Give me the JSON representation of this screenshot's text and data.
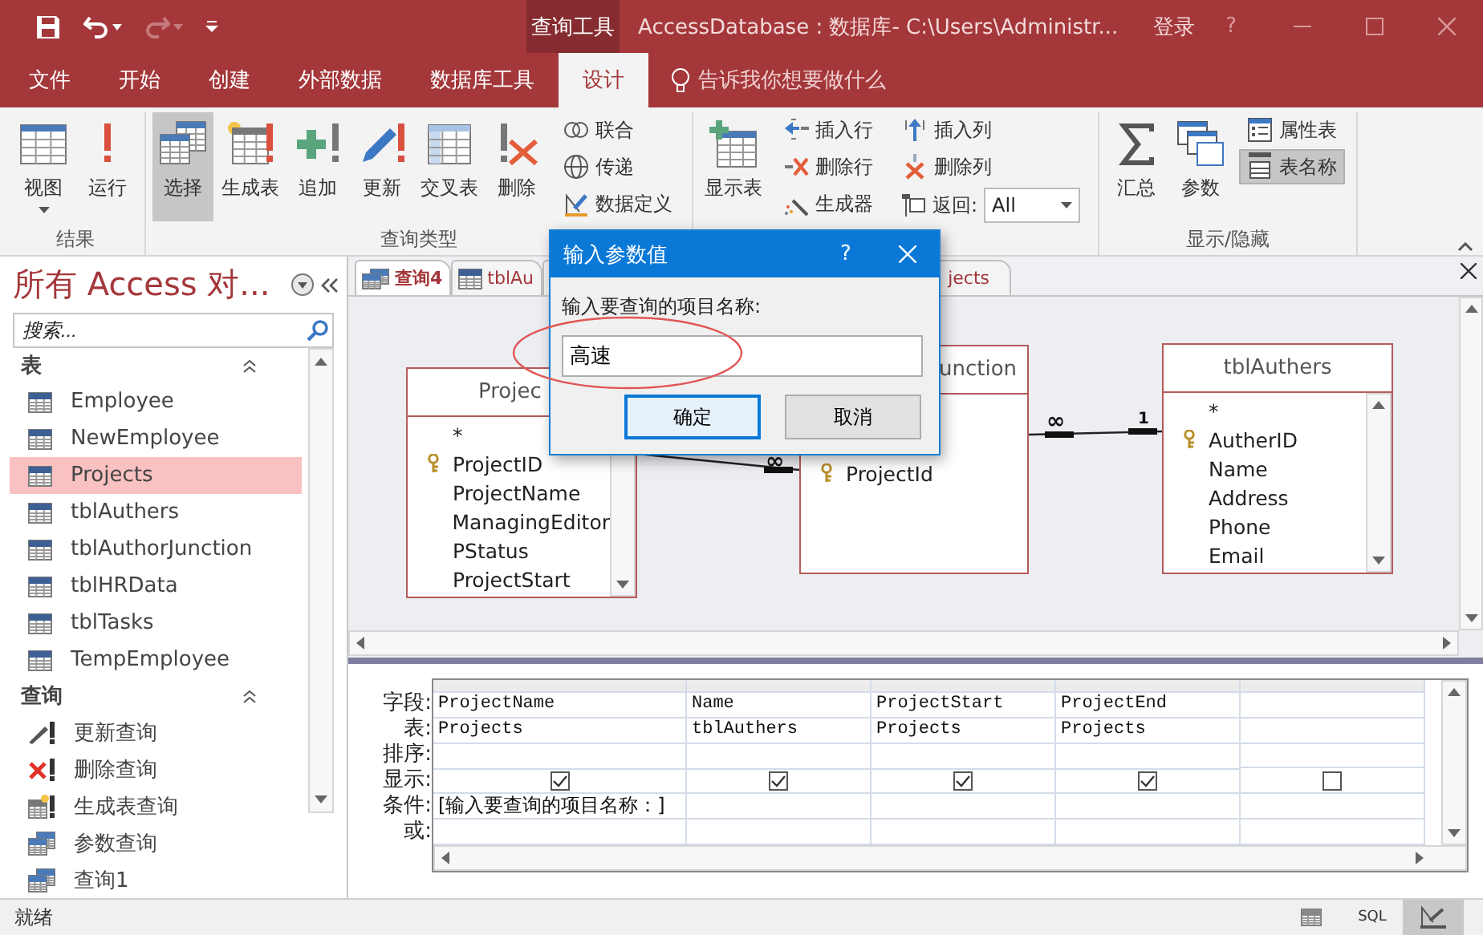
{
  "title_bar": {
    "context_tab": "查询工具",
    "title": "AccessDatabase : 数据库- C:\\Users\\Administr...",
    "sign_in": "登录",
    "help": "?",
    "redo_disabled": true
  },
  "ribbon_tabs": [
    {
      "label": "文件",
      "selected": false
    },
    {
      "label": "开始",
      "selected": false
    },
    {
      "label": "创建",
      "selected": false
    },
    {
      "label": "外部数据",
      "selected": false
    },
    {
      "label": "数据库工具",
      "selected": false
    },
    {
      "label": "设计",
      "selected": true
    }
  ],
  "tell_me": "告诉我你想要做什么",
  "ribbon_groups": [
    {
      "label": "结果",
      "items": [
        {
          "kind": "large",
          "label": "视图",
          "dropdown": true,
          "selected": false
        },
        {
          "kind": "large",
          "label": "运行",
          "dropdown": false,
          "selected": false
        }
      ]
    },
    {
      "label": "查询类型",
      "items": [
        {
          "kind": "large",
          "label": "选择",
          "dropdown": false,
          "selected": true
        },
        {
          "kind": "large",
          "label": "生成表",
          "dropdown": false,
          "selected": false
        },
        {
          "kind": "large",
          "label": "追加",
          "dropdown": false,
          "selected": false
        },
        {
          "kind": "large",
          "label": "更新",
          "dropdown": false,
          "selected": false
        },
        {
          "kind": "large",
          "label": "交叉表",
          "dropdown": false,
          "selected": false
        },
        {
          "kind": "large",
          "label": "删除",
          "dropdown": false,
          "selected": false
        },
        {
          "kind": "stack",
          "buttons": [
            {
              "kind": "button",
              "label": "联合",
              "selected": false
            },
            {
              "kind": "button",
              "label": "传递",
              "selected": false
            },
            {
              "kind": "button",
              "label": "数据定义",
              "selected": false
            }
          ]
        }
      ]
    },
    {
      "items": [
        {
          "kind": "large",
          "label": "显示表",
          "dropdown": false,
          "selected": false
        },
        {
          "kind": "stack",
          "buttons": [
            {
              "kind": "button",
              "label": "插入行",
              "selected": false
            },
            {
              "kind": "button",
              "label": "删除行",
              "selected": false
            },
            {
              "kind": "button",
              "label": "生成器",
              "selected": false
            }
          ]
        },
        {
          "kind": "stack",
          "buttons": [
            {
              "kind": "button",
              "label": "插入列",
              "selected": false
            },
            {
              "kind": "button",
              "label": "删除列",
              "selected": false
            },
            {
              "kind": "combo",
              "label": "返回:",
              "value": "All"
            }
          ]
        }
      ]
    },
    {
      "label": "显示/隐藏",
      "items": [
        {
          "kind": "large",
          "label": "汇总",
          "dropdown": false,
          "selected": false
        },
        {
          "kind": "large",
          "label": "参数",
          "dropdown": false,
          "selected": false
        },
        {
          "kind": "stack",
          "buttons": [
            {
              "kind": "button",
              "label": "属性表",
              "selected": false
            },
            {
              "kind": "button",
              "label": "表名称",
              "selected": true
            }
          ]
        }
      ]
    }
  ],
  "nav": {
    "title": "所有 Access 对...",
    "search_placeholder": "搜索...",
    "groups": [
      {
        "label": "表",
        "items": [
          {
            "kind": "table",
            "label": "Employee",
            "selected": false
          },
          {
            "kind": "table",
            "label": "NewEmployee",
            "selected": false
          },
          {
            "kind": "table",
            "label": "Projects",
            "selected": true
          },
          {
            "kind": "table",
            "label": "tblAuthers",
            "selected": false
          },
          {
            "kind": "table",
            "label": "tblAuthorJunction",
            "selected": false
          },
          {
            "kind": "table",
            "label": "tblHRData",
            "selected": false
          },
          {
            "kind": "table",
            "label": "tblTasks",
            "selected": false
          },
          {
            "kind": "table",
            "label": "TempEmployee",
            "selected": false
          }
        ]
      },
      {
        "label": "查询",
        "items": [
          {
            "kind": "update",
            "label": "更新查询",
            "selected": false
          },
          {
            "kind": "delete",
            "label": "删除查询",
            "selected": false
          },
          {
            "kind": "make_table",
            "label": "生成表查询",
            "selected": false
          },
          {
            "kind": "select",
            "label": "参数查询",
            "selected": false
          },
          {
            "kind": "select",
            "label": "查询1",
            "selected": false
          }
        ]
      }
    ]
  },
  "doc_tabs": [
    {
      "kind": "query",
      "label": "查询4",
      "selected": true
    },
    {
      "kind": "table",
      "label": "tblAu",
      "selected": false
    },
    {
      "label": "jects",
      "selected": false
    }
  ],
  "design_tables": [
    {
      "title": "Projec",
      "fields": [
        {
          "name": "*",
          "key": false
        },
        {
          "name": "ProjectID",
          "key": true
        },
        {
          "name": "ProjectName",
          "key": false
        },
        {
          "name": "ManagingEditor",
          "key": false
        },
        {
          "name": "PStatus",
          "key": false
        },
        {
          "name": "ProjectStart",
          "key": false
        }
      ]
    },
    {
      "title": "unction",
      "fields": [
        {
          "name": "ProjectId",
          "key": true
        }
      ]
    },
    {
      "title": "tblAuthers",
      "fields": [
        {
          "name": "*",
          "key": false
        },
        {
          "name": "AutherID",
          "key": true
        },
        {
          "name": "Name",
          "key": false
        },
        {
          "name": "Address",
          "key": false
        },
        {
          "name": "Phone",
          "key": false
        },
        {
          "name": "Email",
          "key": false
        }
      ]
    }
  ],
  "joins": [
    {
      "many_label": "∞"
    },
    {
      "many_label": "∞",
      "one_label": "1"
    }
  ],
  "grid": {
    "row_labels": [
      "字段:",
      "表:",
      "排序:",
      "显示:",
      "条件:",
      "或:"
    ],
    "columns": [
      {
        "field": "ProjectName",
        "table": "Projects",
        "show": true,
        "criteria": "[输入要查询的项目名称：]"
      },
      {
        "field": "Name",
        "table": "tblAuthers",
        "show": true
      },
      {
        "field": "ProjectStart",
        "table": "Projects",
        "show": true
      },
      {
        "field": "ProjectEnd",
        "table": "Projects",
        "show": true
      },
      {
        "show": false
      }
    ]
  },
  "status_bar": {
    "text": "就绪",
    "views": [
      {
        "kind": "datasheet",
        "selected": false
      },
      {
        "kind": "sql",
        "label": "SQL",
        "selected": false
      },
      {
        "kind": "design",
        "selected": true
      }
    ]
  },
  "dialog": {
    "title": "输入参数值",
    "help": "?",
    "prompt": "输入要查询的项目名称:",
    "value": "高速",
    "highlighted": true,
    "buttons": [
      {
        "label": "确定",
        "focused": true
      },
      {
        "label": "取消",
        "focused": false
      }
    ]
  }
}
